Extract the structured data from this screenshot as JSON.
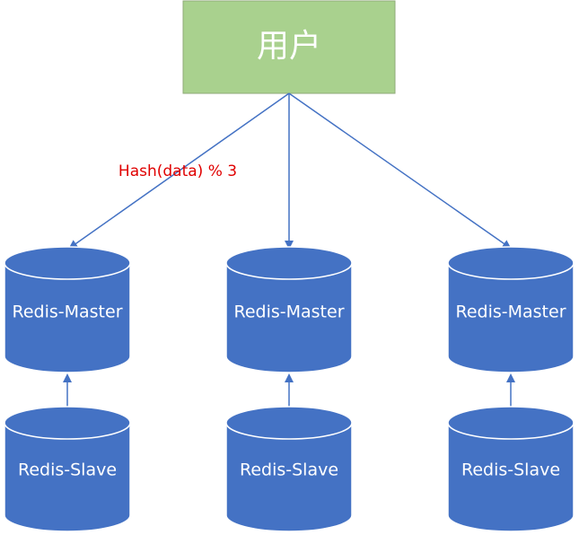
{
  "user_box": {
    "label": "用户",
    "fill": "#a9d18e",
    "stroke": "#8faa78",
    "text_color": "#ffffff"
  },
  "hash_label": {
    "text": "Hash(data) % 3",
    "color": "#e00000"
  },
  "nodes": [
    {
      "master_label": "Redis-Master",
      "slave_label": "Redis-Slave"
    },
    {
      "master_label": "Redis-Master",
      "slave_label": "Redis-Slave"
    },
    {
      "master_label": "Redis-Master",
      "slave_label": "Redis-Slave"
    }
  ],
  "colors": {
    "cylinder_fill": "#4472c4",
    "cylinder_stroke": "#ffffff",
    "cylinder_text": "#ffffff",
    "arrow": "#4472c4"
  },
  "icons": {
    "arrow_head": "arrowhead-icon"
  }
}
